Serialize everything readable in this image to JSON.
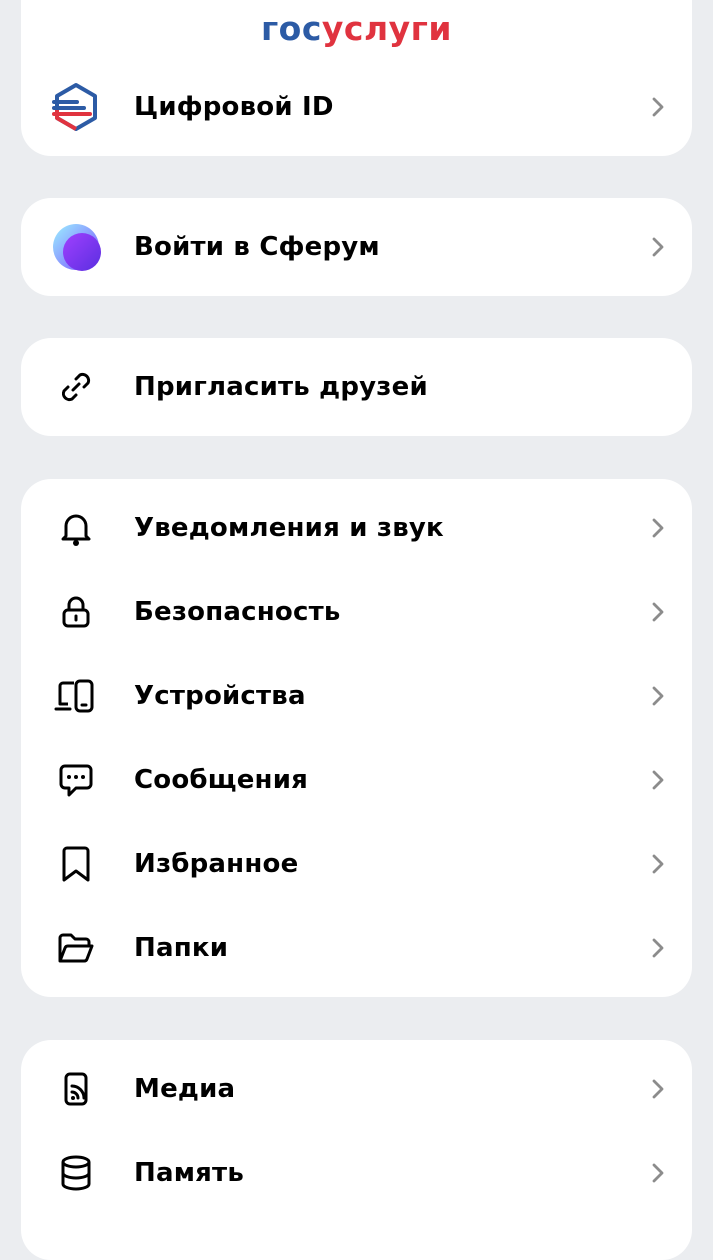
{
  "gosuslugi": {
    "logo_part1": "гос",
    "logo_part2": "услуги",
    "item_label": "Цифровой ID"
  },
  "sferum": {
    "item_label": "Войти в Сферум"
  },
  "invite": {
    "item_label": "Пригласить друзей"
  },
  "settings": {
    "items": [
      {
        "label": "Уведомления и звук",
        "icon": "bell-icon"
      },
      {
        "label": "Безопасность",
        "icon": "lock-icon"
      },
      {
        "label": "Устройства",
        "icon": "devices-icon"
      },
      {
        "label": "Сообщения",
        "icon": "message-icon"
      },
      {
        "label": "Избранное",
        "icon": "bookmark-icon"
      },
      {
        "label": "Папки",
        "icon": "folder-icon"
      }
    ]
  },
  "storage": {
    "items": [
      {
        "label": "Медиа",
        "icon": "media-icon"
      },
      {
        "label": "Память",
        "icon": "database-icon"
      }
    ]
  },
  "colors": {
    "background": "#ebedf0",
    "card": "#ffffff",
    "gos_blue": "#2c5ba5",
    "gos_red": "#e0333f",
    "chevron": "#8c8c8c"
  }
}
